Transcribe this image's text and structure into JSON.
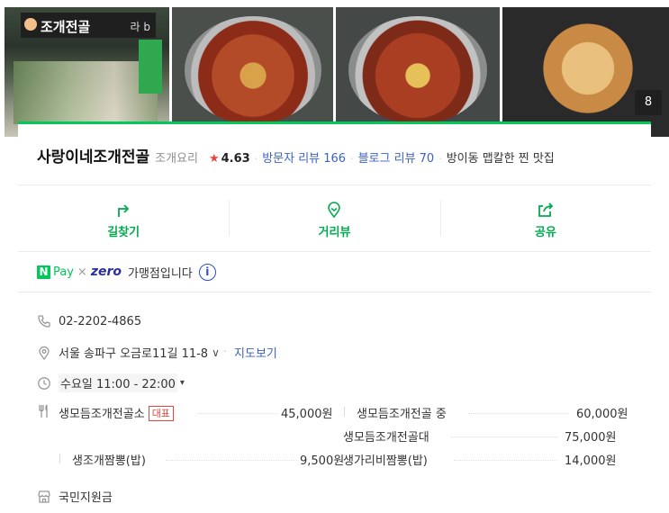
{
  "photos": {
    "sign_text": "조개전골",
    "sign_extra": "라 b",
    "more_count": "8"
  },
  "place": {
    "name": "사랑이네조개전골",
    "category": "조개요리",
    "rating": "4.63",
    "visitor_review": "방문자 리뷰 166",
    "blog_review": "블로그 리뷰 70",
    "description": "방이동 맵칼한 찐 맛집"
  },
  "actions": [
    {
      "label": "길찾기",
      "icon": "directions-icon"
    },
    {
      "label": "거리뷰",
      "icon": "streetview-pin-icon"
    },
    {
      "label": "공유",
      "icon": "share-icon"
    }
  ],
  "npay": {
    "n": "N",
    "pay": "Pay",
    "times": "×",
    "zero": "zero",
    "text": "가맹점입니다",
    "info": "i"
  },
  "details": {
    "phone": "02-2202-4865",
    "address": "서울 송파구 오금로11길 11-8",
    "address_chevron": "∨",
    "address_sep": "·",
    "map_link": "지도보기",
    "hours": "수요일 11:00 - 22:00",
    "hours_chevron": "▾",
    "support": "국민지원금"
  },
  "menu": [
    {
      "name": "생모듬조개전골소",
      "badge": "대표",
      "price": "45,000원"
    },
    {
      "name": "생모듬조개전골 중",
      "price": "60,000원"
    },
    {
      "name": "생모듬조개전골대",
      "price": "75,000원"
    },
    {
      "name": "생조개짬뽕(밥)",
      "price": "9,500원"
    },
    {
      "name": "생가리비짬뽕(밥)",
      "price": "14,000원"
    }
  ],
  "colors": {
    "accent_green": "#03c75a",
    "link_blue": "#3c62c8",
    "star_red": "#e7453c"
  }
}
